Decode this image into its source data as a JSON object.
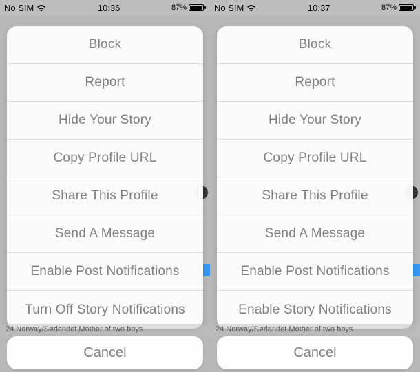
{
  "left": {
    "status": {
      "carrier": "No SIM",
      "time": "10:36",
      "battery_pct": "87%"
    },
    "menu": [
      "Block",
      "Report",
      "Hide Your Story",
      "Copy Profile URL",
      "Share This Profile",
      "Send A Message",
      "Enable Post Notifications",
      "Turn Off Story Notifications"
    ],
    "cancel": "Cancel",
    "bg_text": "24  Norway/Sørlandet  Mother of two boys"
  },
  "right": {
    "status": {
      "carrier": "No SIM",
      "time": "10:37",
      "battery_pct": "87%"
    },
    "menu": [
      "Block",
      "Report",
      "Hide Your Story",
      "Copy Profile URL",
      "Share This Profile",
      "Send A Message",
      "Enable Post Notifications",
      "Enable Story Notifications"
    ],
    "cancel": "Cancel",
    "bg_text": "24  Norway/Sørlandet  Mother of two boys"
  }
}
